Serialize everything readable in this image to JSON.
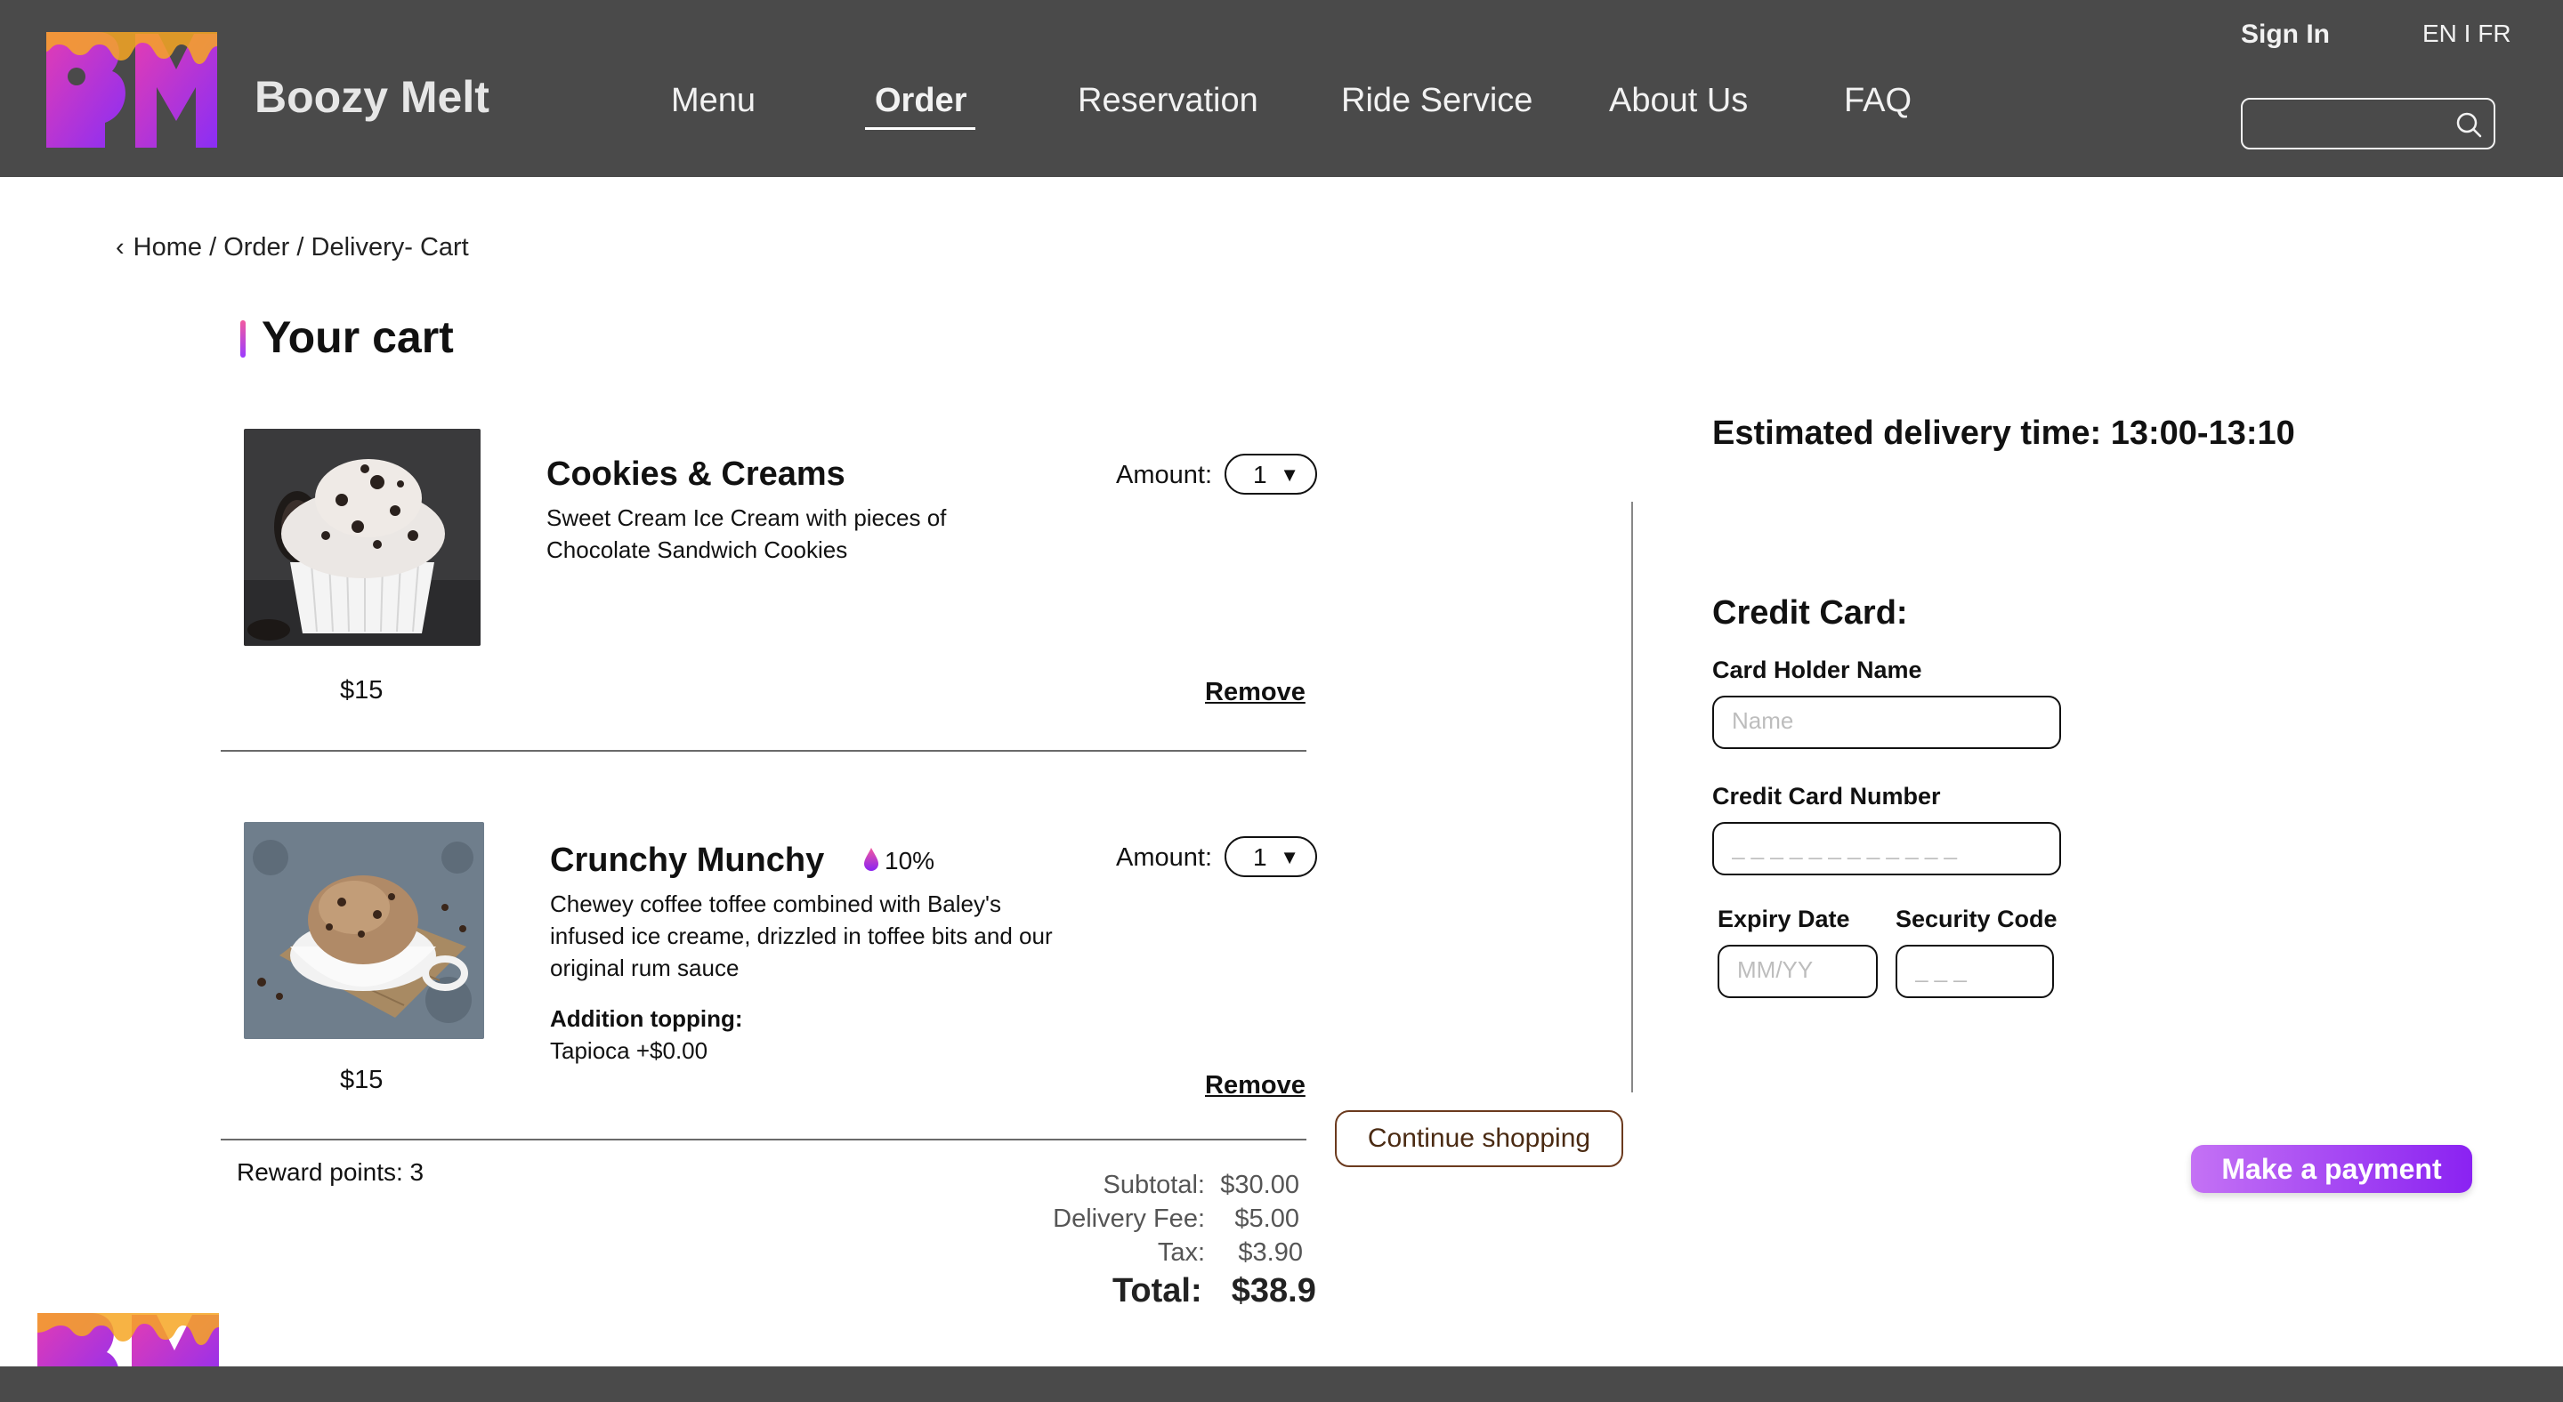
{
  "colors": {
    "header_bg": "#4a4a4a",
    "accent_gradient_start": "#c472f4",
    "accent_gradient_end": "#8a22f2",
    "logo_pink": "#e23cb4",
    "logo_orange": "#f6a623"
  },
  "header": {
    "brand": "Boozy Melt",
    "logo_icon": "bm-logo-icon",
    "nav": [
      "Menu",
      "Order",
      "Reservation",
      "Ride Service",
      "About Us",
      "FAQ"
    ],
    "active_nav": "Order",
    "sign_in": "Sign In",
    "language": "EN I FR",
    "search": {
      "placeholder": "",
      "icon": "search-icon"
    }
  },
  "breadcrumb": "Home / Order / Delivery- Cart",
  "page_title": "Your cart",
  "cart": {
    "items": [
      {
        "name": "Cookies & Creams",
        "description": "Sweet Cream Ice Cream with pieces of Chocolate Sandwich Cookies",
        "price": "$15",
        "amount_label": "Amount:",
        "amount": "1",
        "remove_label": "Remove"
      },
      {
        "name": "Crunchy Munchy",
        "alcohol": "10%",
        "alcohol_icon": "drop-icon",
        "description": "Chewey coffee toffee combined with Baley's infused ice creame, drizzled in toffee bits and our original rum sauce",
        "topping_label": "Addition topping:",
        "topping_value": "Tapioca +$0.00",
        "price": "$15",
        "amount_label": "Amount:",
        "amount": "1",
        "remove_label": "Remove"
      }
    ],
    "reward_points": "Reward points: 3",
    "summary": {
      "subtotal_label": "Subtotal:",
      "subtotal": "$30.00",
      "delivery_label": "Delivery Fee:",
      "delivery": "$5.00",
      "tax_label": "Tax:",
      "tax": "$3.90",
      "total_label": "Total:",
      "total": "$38.9"
    },
    "continue_label": "Continue shopping"
  },
  "checkout": {
    "delivery_time": "Estimated delivery  time: 13:00-13:10",
    "credit_card_title": "Credit Card:",
    "holder_label": "Card Holder Name",
    "holder_placeholder": "Name",
    "number_label": "Credit Card Number",
    "number_placeholder": "_ _ _ _ _ _ _ _ _ _ _ _",
    "expiry_label": "Expiry Date",
    "expiry_placeholder": "MM/YY",
    "security_label": "Security Code",
    "security_placeholder": "_ _ _",
    "pay_label": "Make a payment"
  }
}
